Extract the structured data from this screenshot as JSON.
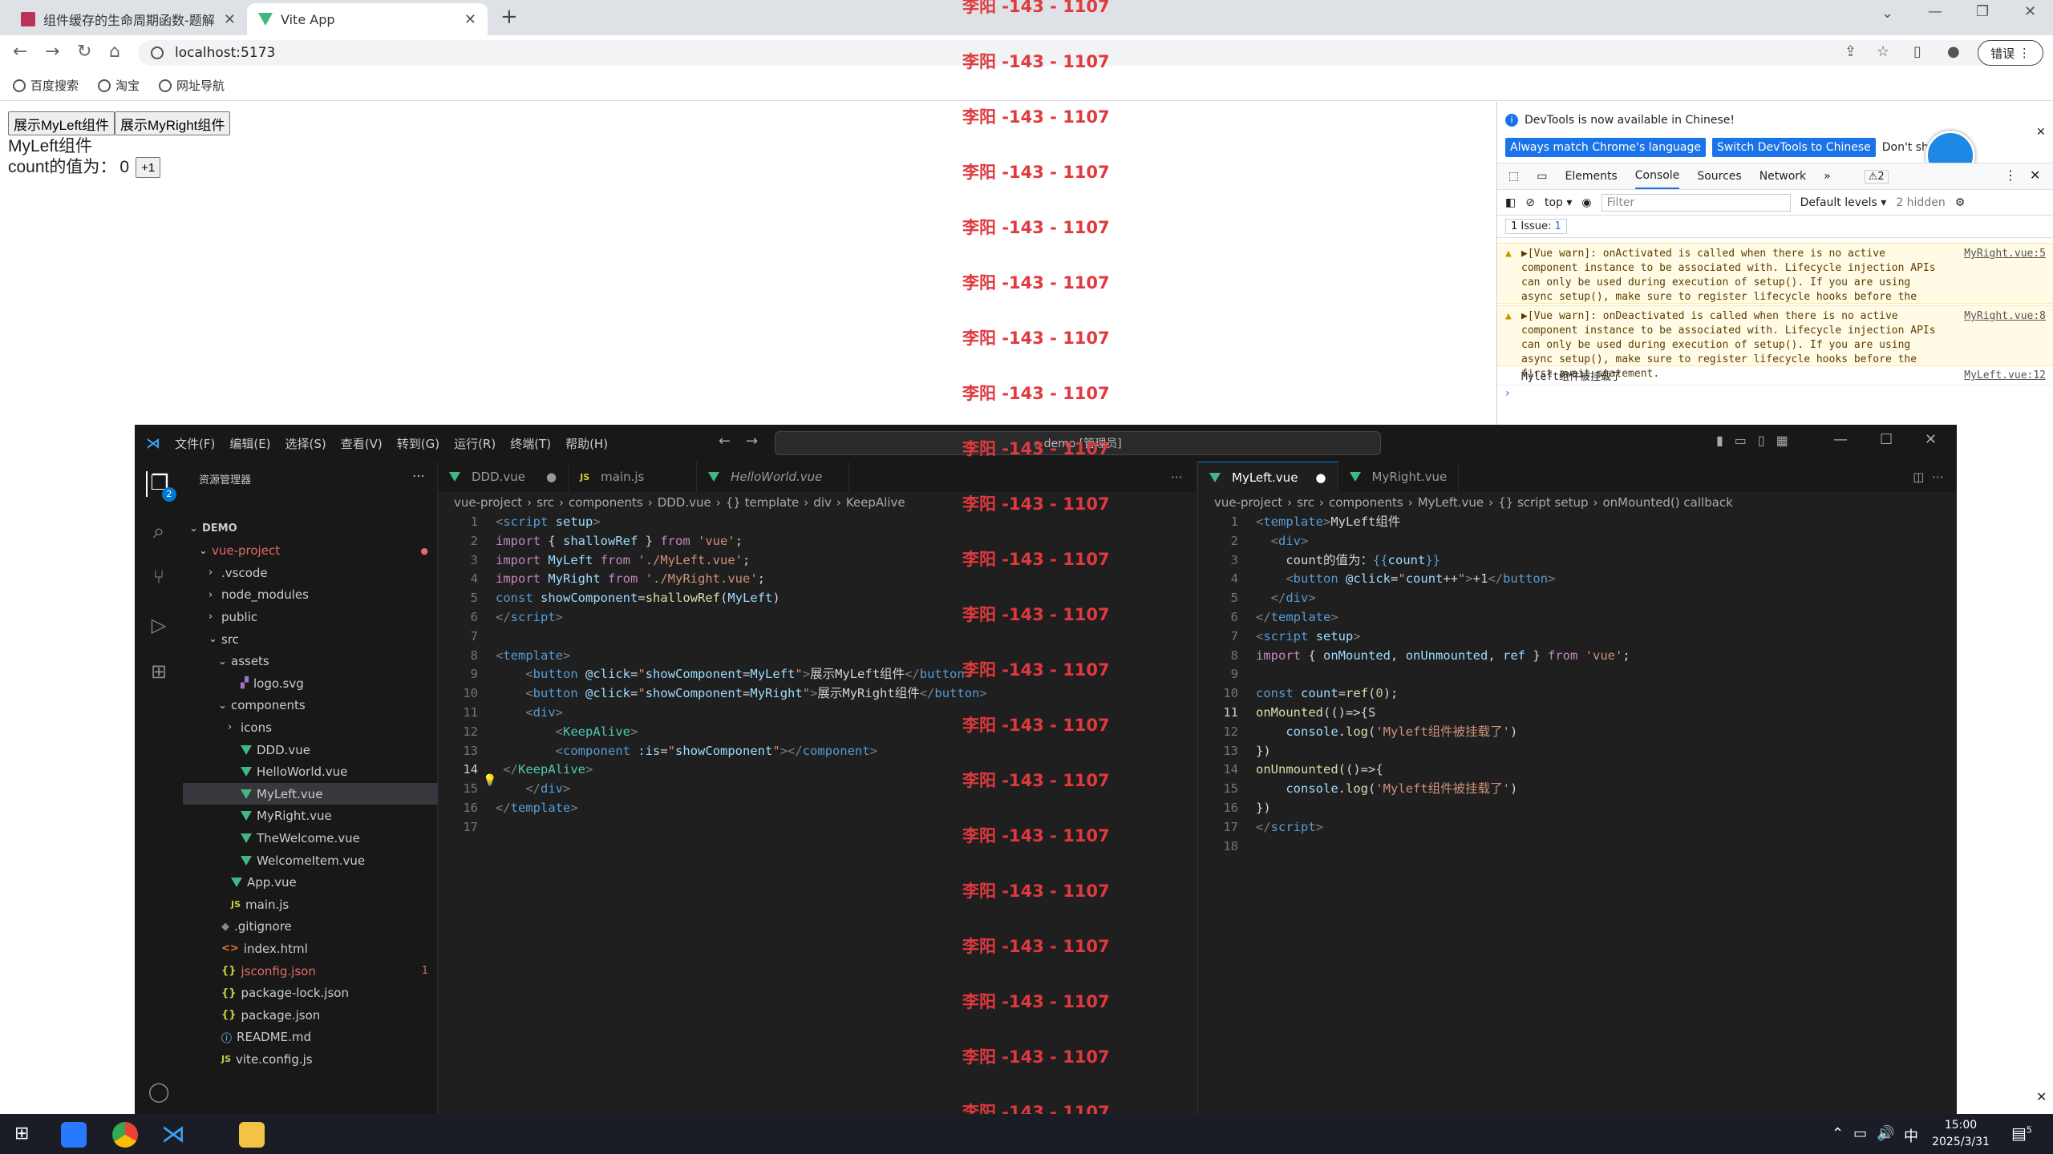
{
  "browser": {
    "tabs": [
      {
        "title": "组件缓存的生命周期函数-题解"
      },
      {
        "title": "Vite App"
      }
    ],
    "url": "localhost:5173",
    "profile_button": "错误",
    "bookmarks": [
      "百度搜索",
      "淘宝",
      "网址导航"
    ]
  },
  "page": {
    "btn_left": "展示MyLeft组件",
    "btn_right": "展示MyRight组件",
    "component_title": "MyLeft组件",
    "count_label": "count的值为：",
    "count_value": "0",
    "plus_btn": "+1"
  },
  "devtools": {
    "notice": "DevTools is now available in Chinese!",
    "btn_match": "Always match Chrome's language",
    "btn_switch": "Switch DevTools to Chinese",
    "btn_dontshow": "Don't show",
    "tabs": [
      "Elements",
      "Console",
      "Sources",
      "Network"
    ],
    "warn_count": "2",
    "context": "top",
    "filter_placeholder": "Filter",
    "levels": "Default levels",
    "hidden": "2 hidden",
    "issues": "1 Issue:",
    "issues_count": "1",
    "messages": [
      {
        "text": "▶[Vue warn]: onActivated is called when there is no active component instance to be associated with. Lifecycle injection APIs can only be used during execution of setup(). If you are using async setup(), make sure to register lifecycle hooks before the first await statement.",
        "source": "MyRight.vue:5"
      },
      {
        "text": "▶[Vue warn]: onDeactivated is called when there is no active component instance to be associated with. Lifecycle injection APIs can only be used during execution of setup(). If you are using async setup(), make sure to register lifecycle hooks before the first await statement.",
        "source": "MyRight.vue:8"
      }
    ],
    "log": {
      "text": "Myleft组件被挂载了",
      "source": "MyLeft.vue:12"
    }
  },
  "vscode": {
    "menus": [
      "文件(F)",
      "编辑(E)",
      "选择(S)",
      "查看(V)",
      "转到(G)",
      "运行(R)",
      "终端(T)",
      "帮助(H)"
    ],
    "search": "demo [管理员]",
    "explorer_title": "资源管理器",
    "badge": "2",
    "tree": [
      {
        "label": "DEMO",
        "depth": 0,
        "type": "folder",
        "open": true
      },
      {
        "label": "vue-project",
        "depth": 1,
        "type": "folder",
        "open": true,
        "color": "#e06c65"
      },
      {
        "label": ".vscode",
        "depth": 2,
        "type": "folder"
      },
      {
        "label": "node_modules",
        "depth": 2,
        "type": "folder"
      },
      {
        "label": "public",
        "depth": 2,
        "type": "folder"
      },
      {
        "label": "src",
        "depth": 2,
        "type": "folder",
        "open": true
      },
      {
        "label": "assets",
        "depth": 3,
        "type": "folder",
        "open": true
      },
      {
        "label": "logo.svg",
        "depth": 4,
        "type": "svg"
      },
      {
        "label": "components",
        "depth": 3,
        "type": "folder",
        "open": true
      },
      {
        "label": "icons",
        "depth": 4,
        "type": "folder"
      },
      {
        "label": "DDD.vue",
        "depth": 4,
        "type": "vue"
      },
      {
        "label": "HelloWorld.vue",
        "depth": 4,
        "type": "vue"
      },
      {
        "label": "MyLeft.vue",
        "depth": 4,
        "type": "vue",
        "selected": true
      },
      {
        "label": "MyRight.vue",
        "depth": 4,
        "type": "vue"
      },
      {
        "label": "TheWelcome.vue",
        "depth": 4,
        "type": "vue"
      },
      {
        "label": "WelcomeItem.vue",
        "depth": 4,
        "type": "vue"
      },
      {
        "label": "App.vue",
        "depth": 3,
        "type": "vue"
      },
      {
        "label": "main.js",
        "depth": 3,
        "type": "js"
      },
      {
        "label": ".gitignore",
        "depth": 2,
        "type": "git"
      },
      {
        "label": "index.html",
        "depth": 2,
        "type": "html"
      },
      {
        "label": "jsconfig.json",
        "depth": 2,
        "type": "json",
        "color": "#e06c65",
        "badge": "1"
      },
      {
        "label": "package-lock.json",
        "depth": 2,
        "type": "json"
      },
      {
        "label": "package.json",
        "depth": 2,
        "type": "json"
      },
      {
        "label": "README.md",
        "depth": 2,
        "type": "info"
      },
      {
        "label": "vite.config.js",
        "depth": 2,
        "type": "js"
      }
    ],
    "editor1": {
      "tabs": [
        "DDD.vue",
        "main.js",
        "HelloWorld.vue"
      ],
      "breadcrumb": [
        "vue-project",
        "src",
        "components",
        "DDD.vue",
        "{} template",
        "div",
        "KeepAlive"
      ]
    },
    "editor2": {
      "tabs": [
        "MyLeft.vue",
        "MyRight.vue"
      ],
      "breadcrumb": [
        "vue-project",
        "src",
        "components",
        "MyLeft.vue",
        "{} script setup",
        "onMounted() callback"
      ]
    }
  },
  "watermark": "李阳 -143 - 1107",
  "taskbar": {
    "time": "15:00",
    "date": "2025/3/31",
    "ime": "中",
    "notif": "5"
  }
}
